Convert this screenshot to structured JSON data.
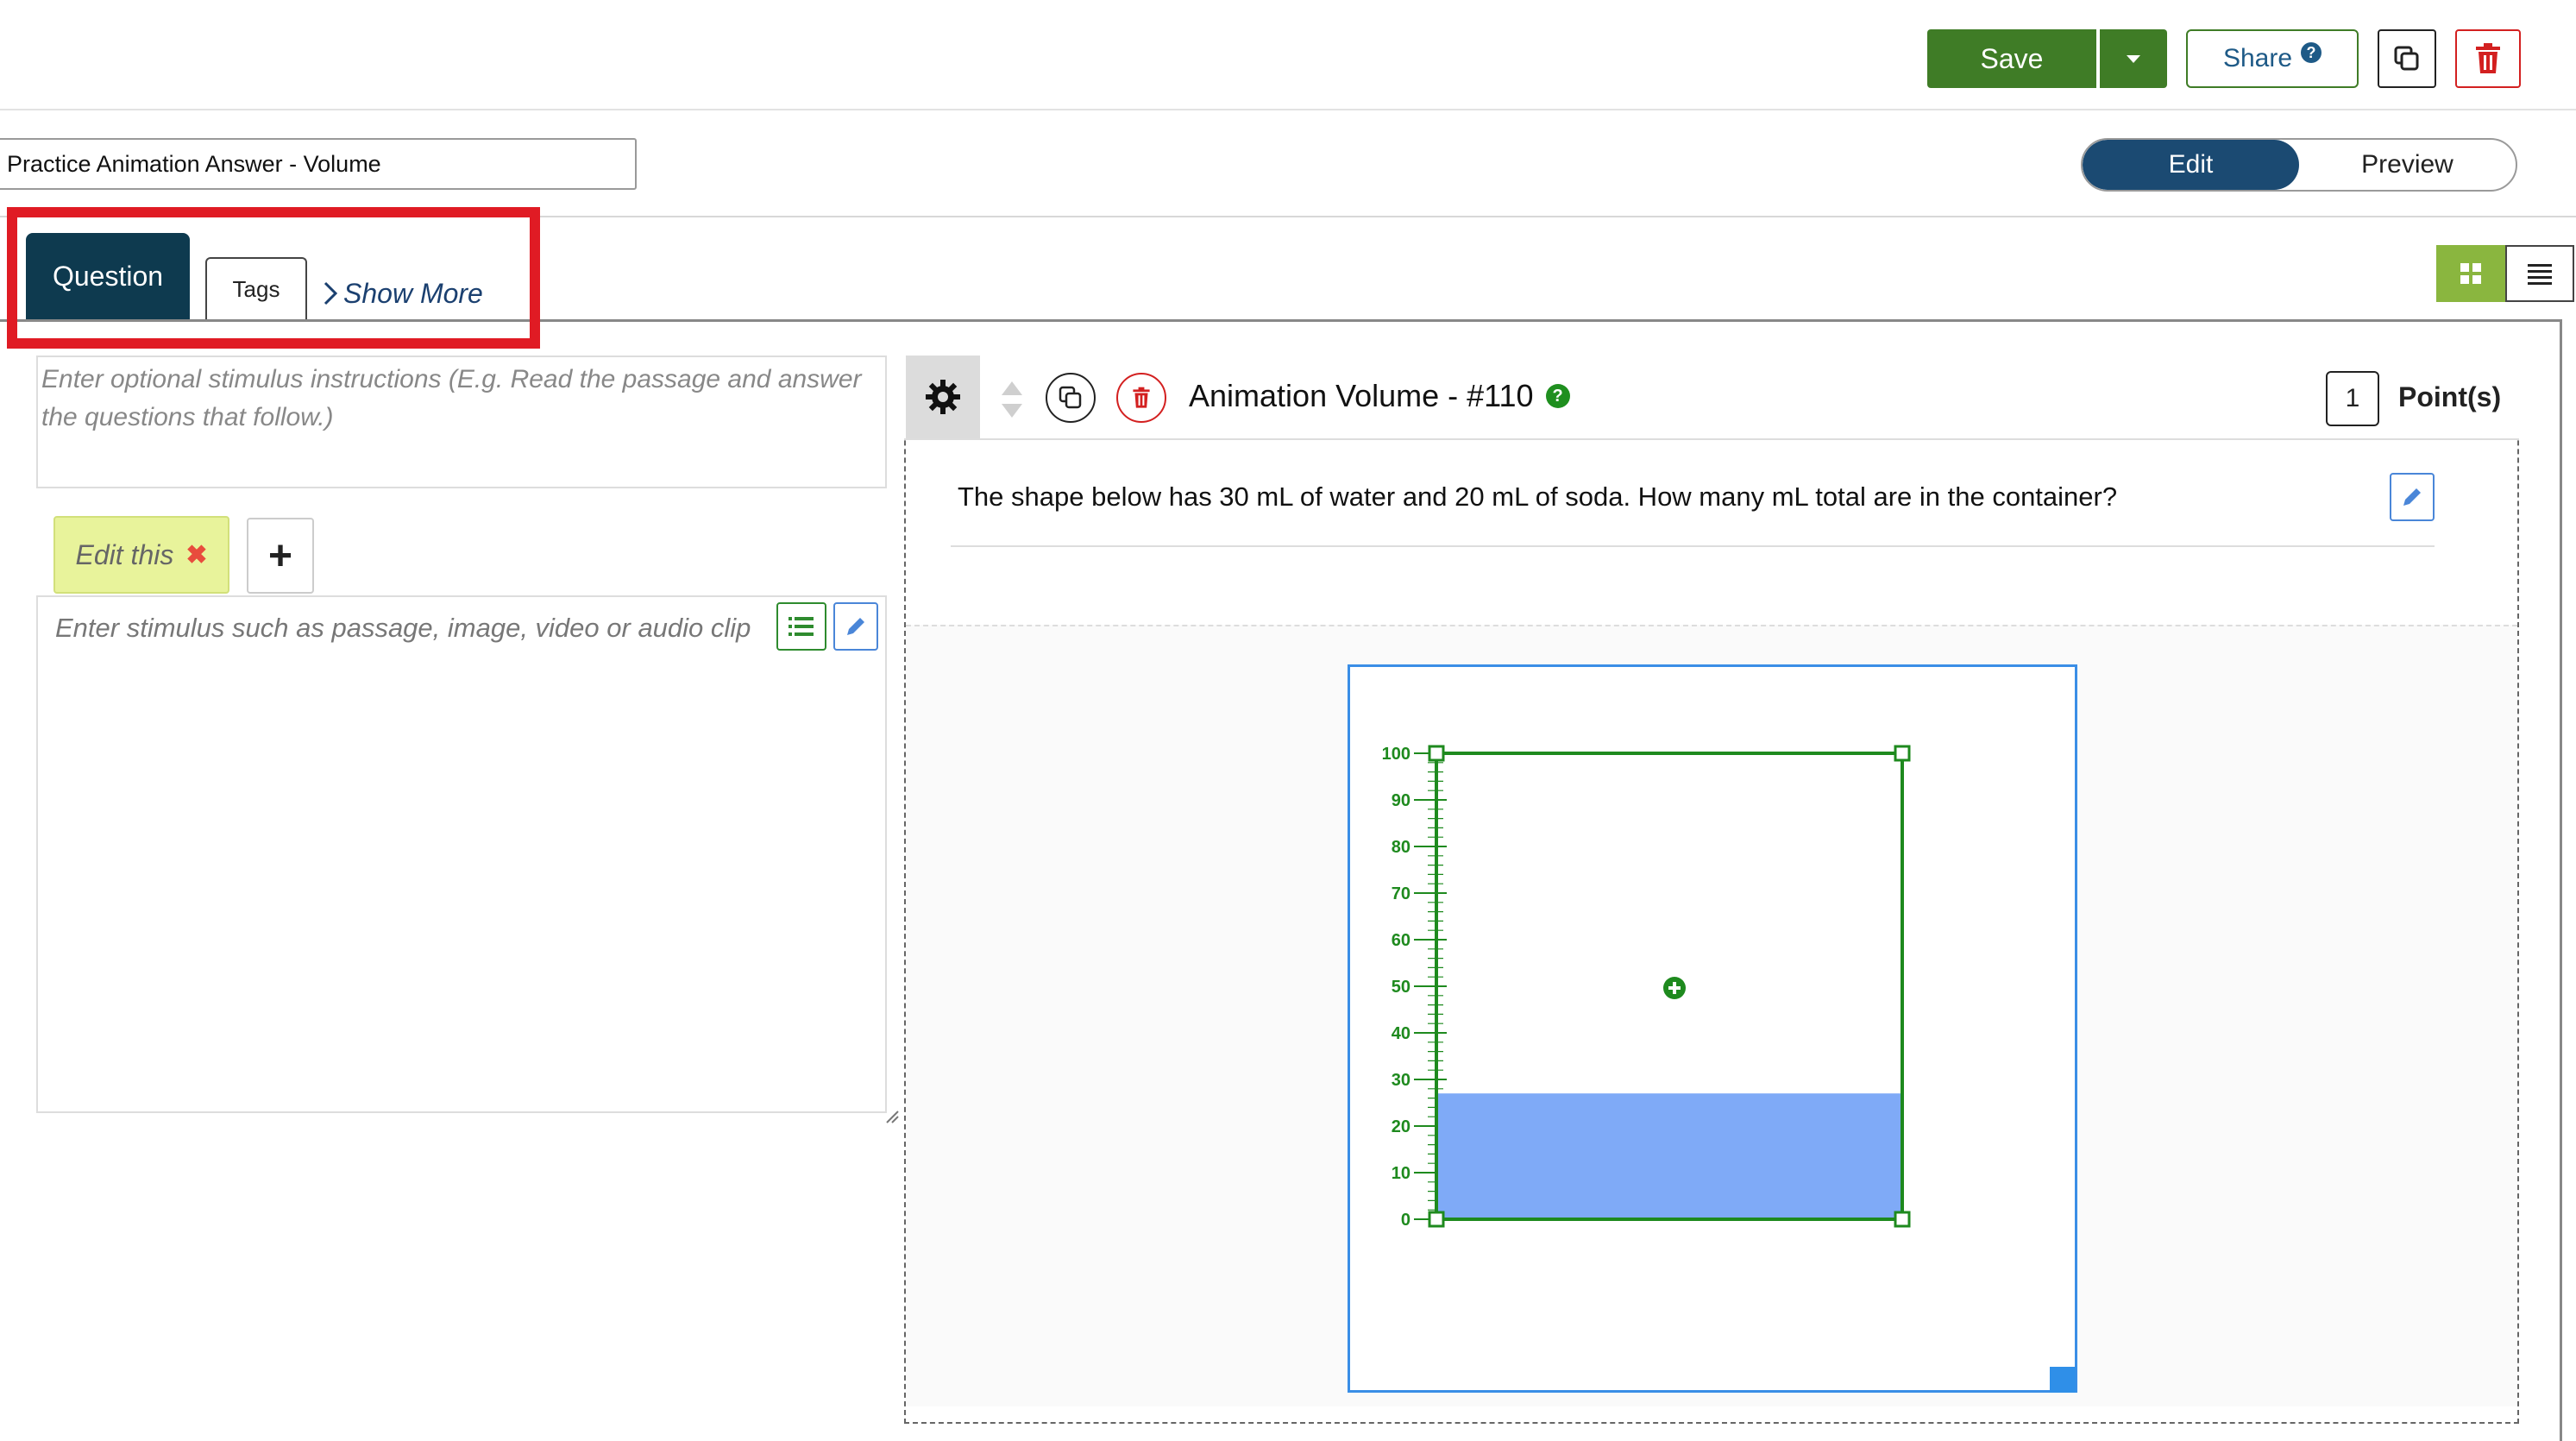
{
  "toolbar": {
    "save_label": "Save",
    "share_label": "Share",
    "share_help": "?"
  },
  "title_input": {
    "value": "Practice Animation Answer - Volume"
  },
  "mode_toggle": {
    "edit_label": "Edit",
    "preview_label": "Preview",
    "active": "Edit"
  },
  "tabs": {
    "question_label": "Question",
    "tags_label": "Tags",
    "show_more_label": "Show More"
  },
  "stimulus": {
    "instructions_placeholder": "Enter optional stimulus instructions (E.g. Read the passage and answer the questions that follow.)",
    "edit_chip_label": "Edit this",
    "chip_remove": "✖",
    "add_label": "+",
    "content_placeholder": "Enter stimulus such as passage, image, video or audio clip"
  },
  "question": {
    "title": "Animation Volume - #110",
    "help": "?",
    "points_value": "1",
    "points_label": "Point(s)",
    "text": "The shape below has 30 mL of water and 20 mL of soda. How many mL total are in the container?"
  },
  "container": {
    "scale_labels": [
      "100",
      "90",
      "80",
      "70",
      "60",
      "50",
      "40",
      "30",
      "20",
      "10",
      "0"
    ],
    "scale_max": 100,
    "fill_level": 27,
    "fill_color": "#7faaf7",
    "outline_color": "#1e8a1e"
  },
  "colors": {
    "accent_green": "#3f7c26",
    "tab_active": "#0e3a4f",
    "toggle_active": "#1b4a72",
    "highlight_red": "#e01b24"
  }
}
